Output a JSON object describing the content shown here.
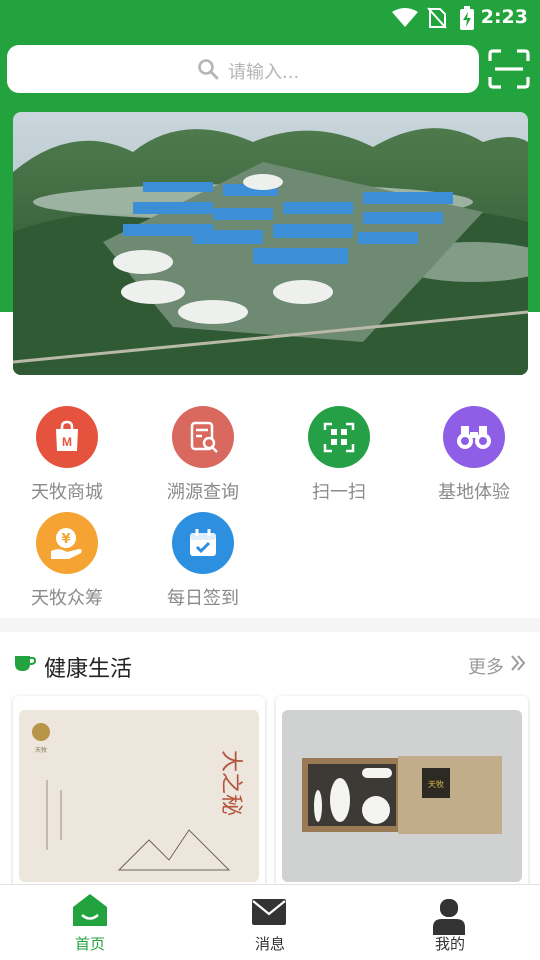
{
  "status_bar": {
    "time": "2:23",
    "icons": [
      "wifi-icon",
      "no-sim-icon",
      "battery-charging-icon"
    ]
  },
  "search": {
    "placeholder": "请输入...",
    "icon": "search-icon",
    "scan_icon": "scan-icon"
  },
  "banner": {
    "alt": "industrial park aerial view"
  },
  "quick_actions": [
    {
      "label": "天牧商城",
      "icon": "shopping-bag-icon",
      "color": "#e5533f"
    },
    {
      "label": "溯源查询",
      "icon": "trace-query-icon",
      "color": "#d9685e"
    },
    {
      "label": "扫一扫",
      "icon": "qr-scan-icon",
      "color": "#25a046"
    },
    {
      "label": "基地体验",
      "icon": "binoculars-icon",
      "color": "#8e5fe6"
    },
    {
      "label": "天牧众筹",
      "icon": "crowdfunding-icon",
      "color": "#f5a433"
    },
    {
      "label": "每日签到",
      "icon": "calendar-check-icon",
      "color": "#2d8fe0"
    }
  ],
  "section": {
    "title": "健康生活",
    "more": "更多",
    "icon": "tea-cup-icon"
  },
  "cards": [
    {
      "name": "health-card-1",
      "badge": "天牧",
      "script": "大之秘"
    },
    {
      "name": "health-card-2",
      "box_text": "天牧"
    }
  ],
  "tabs": [
    {
      "label": "首页",
      "icon": "home-icon",
      "active": true
    },
    {
      "label": "消息",
      "icon": "mail-icon",
      "active": false
    },
    {
      "label": "我的",
      "icon": "user-icon",
      "active": false
    }
  ],
  "colors": {
    "brand_green": "#22a33d",
    "text_gray": "#8a8a8a"
  }
}
